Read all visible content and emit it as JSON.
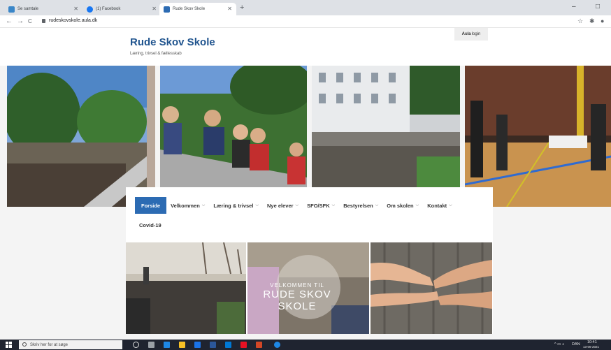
{
  "browser": {
    "tabs": [
      {
        "title": "Se samtale",
        "icon_color": "#3a86c8",
        "active": false
      },
      {
        "title": "(1) Facebook",
        "icon_color": "#1877f2",
        "active": false
      },
      {
        "title": "Rude Skov Skole",
        "icon_color": "#2c6bb3",
        "active": true
      }
    ],
    "new_tab": "+",
    "window_controls": {
      "minimize": "–",
      "restore": "□"
    },
    "nav": {
      "back": "←",
      "forward": "→",
      "reload": "C"
    },
    "url": "rudeskovskole.aula.dk",
    "extensions": {
      "star": "☆",
      "puzzle": "✱",
      "profile": "●"
    }
  },
  "site": {
    "title": "Rude Skov Skole",
    "tagline": "Læring, trivsel & fællesskab",
    "aula": {
      "brand": "Aula",
      "label": "login"
    }
  },
  "nav": {
    "items": [
      {
        "label": "Forside",
        "active": true,
        "dropdown": false
      },
      {
        "label": "Velkommen",
        "dropdown": true
      },
      {
        "label": "Læring & trivsel",
        "dropdown": true
      },
      {
        "label": "Nye elever",
        "dropdown": true
      },
      {
        "label": "SFO/SFK",
        "dropdown": true
      },
      {
        "label": "Bestyrelsen",
        "dropdown": true
      },
      {
        "label": "Om skolen",
        "dropdown": true
      },
      {
        "label": "Kontakt",
        "dropdown": true
      }
    ],
    "row2": {
      "label": "Covid-19"
    },
    "chevron": "⌵"
  },
  "banner": {
    "line1": "VELKOMMEN TIL",
    "line2": "RUDE SKOV SKOLE"
  },
  "taskbar": {
    "search_placeholder": "Skriv her for at søge",
    "tray": {
      "lang": "DAN",
      "time": "10:41",
      "date": "13-06-2021"
    }
  },
  "colors": {
    "accent": "#2c6bb3",
    "title": "#21558f"
  }
}
